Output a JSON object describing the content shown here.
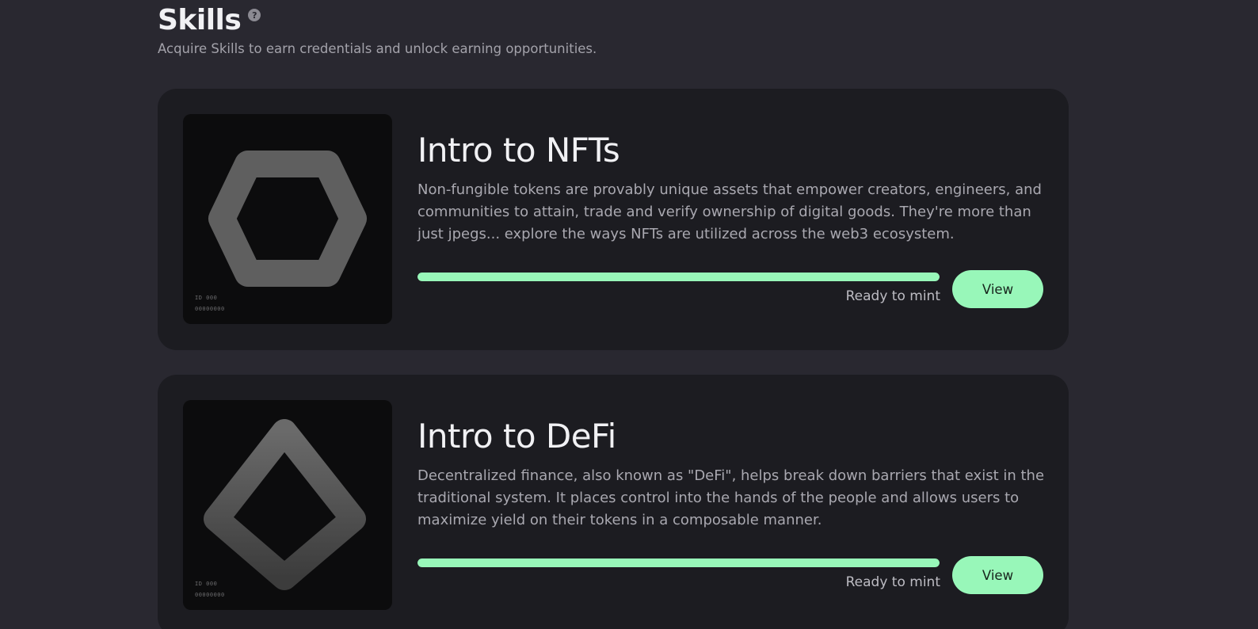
{
  "header": {
    "title": "Skills",
    "help_icon": "question-circle-icon",
    "subtitle": "Acquire Skills to earn credentials and unlock earning opportunities."
  },
  "colors": {
    "background": "#292830",
    "card": "#1c1c21",
    "accent": "#98f7b9",
    "thumbnail": "#0c0c0d"
  },
  "skills": [
    {
      "title": "Intro to NFTs",
      "description": "Non-fungible tokens are provably unique assets that empower creators, engineers, and communities to attain, trade and verify ownership of digital goods. They're more than just jpegs... explore the ways NFTs are utilized across the web3 ecosystem.",
      "progress": 1.0,
      "status": "Ready to mint",
      "button_label": "View",
      "icon": "hexagon-icon",
      "id_line_1": "ID  000",
      "id_line_2": "00000000"
    },
    {
      "title": "Intro to DeFi",
      "description": "Decentralized finance, also known as \"DeFi\", helps break down barriers that exist in the traditional system. It places control into the hands of the people and allows users to maximize yield on their tokens in a composable manner.",
      "progress": 1.0,
      "status": "Ready to mint",
      "button_label": "View",
      "icon": "diamond-split-icon",
      "id_line_1": "ID  000",
      "id_line_2": "00000000"
    }
  ]
}
